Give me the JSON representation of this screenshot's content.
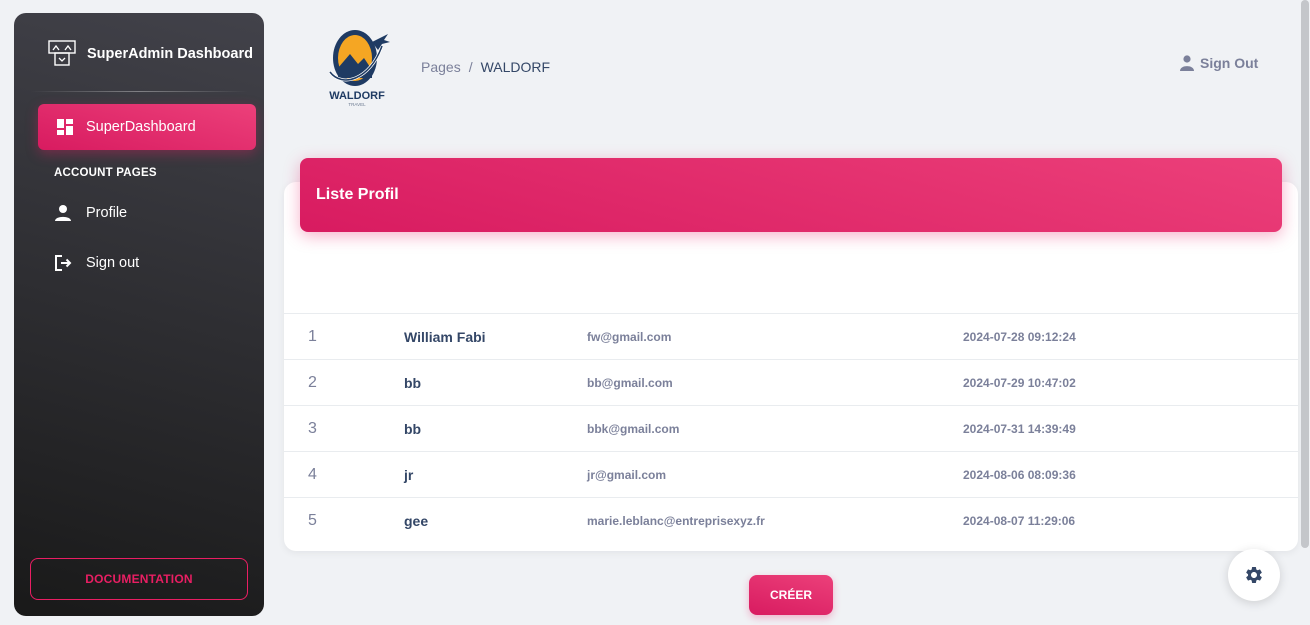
{
  "sidebar": {
    "brand": "SuperAdmin Dashboard",
    "active_item": "SuperDashboard",
    "section_title": "ACCOUNT PAGES",
    "items": [
      {
        "label": "Profile",
        "icon": "person-icon"
      },
      {
        "label": "Sign out",
        "icon": "logout-icon"
      }
    ],
    "documentation": "DOCUMENTATION"
  },
  "header": {
    "logo_text": "WALDORF",
    "logo_subtext": "TRAVEL",
    "breadcrumb_root": "Pages",
    "breadcrumb_separator": "/",
    "breadcrumb_current": "WALDORF",
    "signout": "Sign Out"
  },
  "card": {
    "title": "Liste Profil",
    "rows": [
      {
        "num": "1",
        "name": "William Fabi",
        "email": "fw@gmail.com",
        "date": "2024-07-28 09:12:24"
      },
      {
        "num": "2",
        "name": "bb",
        "email": "bb@gmail.com",
        "date": "2024-07-29 10:47:02"
      },
      {
        "num": "3",
        "name": "bb",
        "email": "bbk@gmail.com",
        "date": "2024-07-31 14:39:49"
      },
      {
        "num": "4",
        "name": "jr",
        "email": "jr@gmail.com",
        "date": "2024-08-06 08:09:36"
      },
      {
        "num": "5",
        "name": "gee",
        "email": "marie.leblanc@entreprisexyz.fr",
        "date": "2024-08-07 11:29:06"
      }
    ]
  },
  "actions": {
    "create": "CRÉER"
  },
  "colors": {
    "accent": "#e91e63",
    "sidebar_dark": "#191919"
  }
}
